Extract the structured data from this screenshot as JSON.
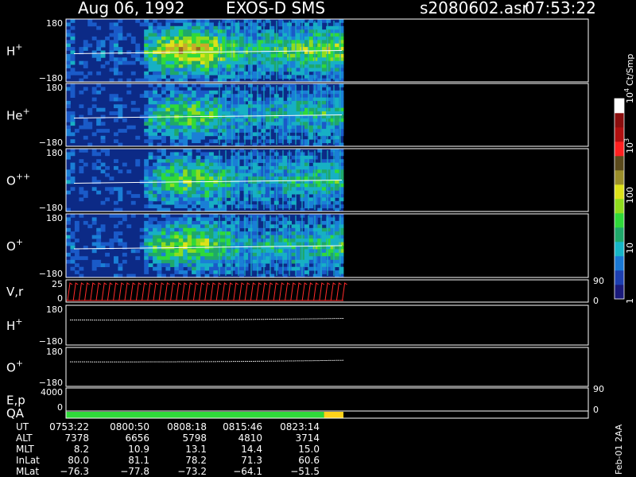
{
  "header": {
    "date": "Aug 06, 1992",
    "instrument": "EXOS-D SMS",
    "file": "s2080602.asr",
    "time": "07:53:22"
  },
  "colors": {
    "background": "#000000",
    "panel_bg": "#0c2a86",
    "qa_good": "#2fd93a",
    "qa_warn": "#ffd21a",
    "vr_trace": "#ff2a2a",
    "border": "#ffffff"
  },
  "chart_data": {
    "type": "heatmap",
    "title": "Aug 06, 1992   EXOS-D SMS",
    "panels": [
      {
        "id": "h-plus",
        "label": "H",
        "sup": "+",
        "kind": "spectrogram",
        "ymax": "180",
        "ymin": "−180",
        "intensity": 1.0
      },
      {
        "id": "he-plus",
        "label": "He",
        "sup": "+",
        "kind": "spectrogram",
        "ymax": "180",
        "ymin": "−180",
        "intensity": 0.7
      },
      {
        "id": "o-plusplus",
        "label": "O",
        "sup": "++",
        "kind": "spectrogram",
        "ymax": "180",
        "ymin": "−180",
        "intensity": 0.72
      },
      {
        "id": "o-plus",
        "label": "O",
        "sup": "+",
        "kind": "spectrogram",
        "ymax": "180",
        "ymin": "−180",
        "intensity": 0.78
      },
      {
        "id": "vr",
        "label": "V,r",
        "sup": "",
        "kind": "vr",
        "ymax": "25",
        "ymin": "0",
        "rmax": "90",
        "rmin": "0"
      },
      {
        "id": "h-plus-2",
        "label": "H",
        "sup": "+",
        "kind": "trace",
        "ymax": "180",
        "ymin": "−180"
      },
      {
        "id": "o-plus-2",
        "label": "O",
        "sup": "+",
        "kind": "trace",
        "ymax": "180",
        "ymin": "−180"
      },
      {
        "id": "ep",
        "label": "E,p",
        "sup": "",
        "kind": "ep",
        "ymax": "4000",
        "ymin": "0",
        "rmax": "90",
        "rmin": "0"
      }
    ],
    "qa_label": "QA",
    "qa_segments": [
      {
        "t_start": 0.0,
        "t_end": 0.93,
        "status": "good"
      },
      {
        "t_start": 0.93,
        "t_end": 1.0,
        "status": "warn"
      }
    ],
    "data_coverage_end": 1.0,
    "ephemeris": {
      "labels": [
        "UT",
        "ALT",
        "MLT",
        "InLat",
        "MLat"
      ],
      "columns": [
        [
          "0753:22",
          "7378",
          "8.2",
          "80.0",
          "−76.3"
        ],
        [
          "0800:50",
          "6656",
          "10.9",
          "81.1",
          "−77.8"
        ],
        [
          "0808:18",
          "5798",
          "13.1",
          "78.2",
          "−73.2"
        ],
        [
          "0815:46",
          "4810",
          "14.4",
          "71.3",
          "−64.1"
        ],
        [
          "0823:14",
          "3714",
          "15.0",
          "60.6",
          "−51.5"
        ]
      ]
    },
    "colorbar": {
      "unit": "Ct/Smp",
      "scale": "log",
      "range": [
        1,
        10000
      ],
      "tick_labels": [
        {
          "base": "1",
          "exp": ""
        },
        {
          "base": "10",
          "exp": ""
        },
        {
          "base": "100",
          "exp": ""
        },
        {
          "base": "10",
          "exp": "3"
        },
        {
          "base": "10",
          "exp": "4"
        }
      ],
      "tick_values": [
        1,
        10,
        100,
        1000,
        10000
      ],
      "colors": [
        "#1a1a7a",
        "#1d3fb0",
        "#1a78d4",
        "#17b6c7",
        "#1fa86a",
        "#2fd93a",
        "#8fdc1e",
        "#dde21a",
        "#9a8e2a",
        "#5a4a1c",
        "#ff2020",
        "#b01010",
        "#8a0e0e",
        "#ffffff"
      ]
    },
    "footer": "Feb-01 2AA"
  }
}
